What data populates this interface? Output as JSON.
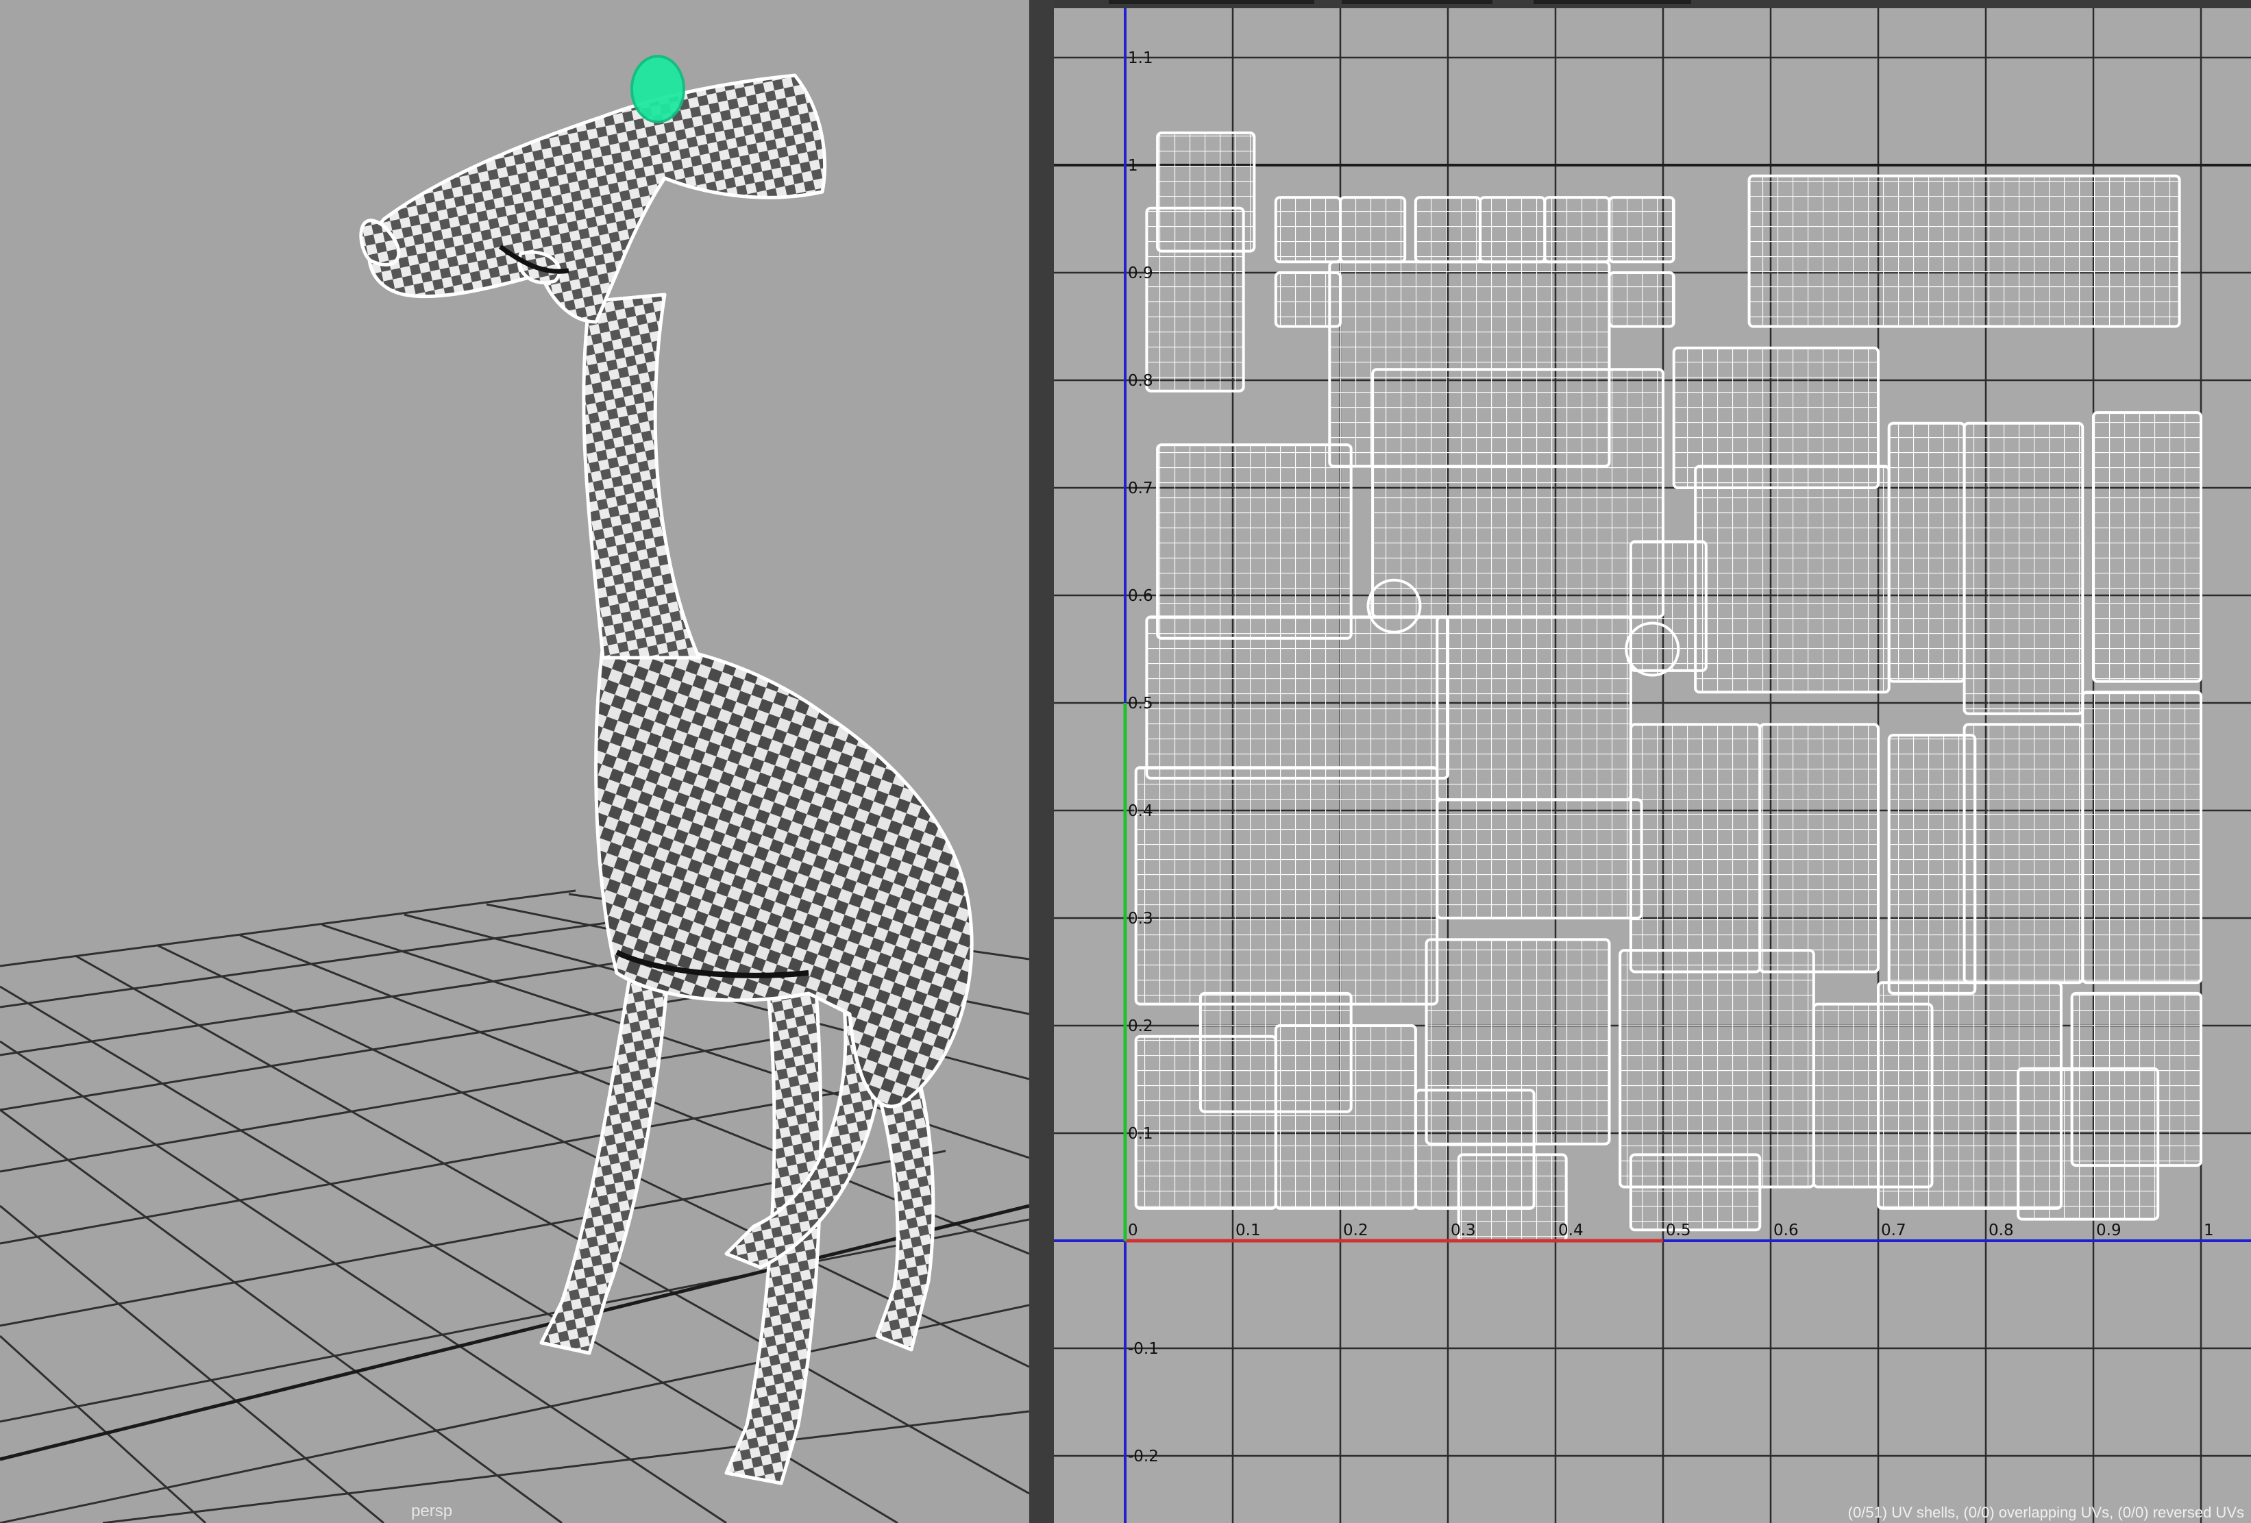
{
  "viewport": {
    "camera_label": "persp",
    "selection_color": "#1ee8a0",
    "grid_color": "#2e2e2e"
  },
  "uv_editor": {
    "y_ticks": [
      "1.1",
      "1",
      "0.9",
      "0.8",
      "0.7",
      "0.6",
      "0.5",
      "0.4",
      "0.3",
      "0.2",
      "0.1",
      "-0.1",
      "-0.2"
    ],
    "x_ticks": [
      "0",
      "0.1",
      "0.2",
      "0.3",
      "0.4",
      "0.5",
      "0.6",
      "0.7",
      "0.8",
      "0.9",
      "1"
    ],
    "status_text": "(0/51) UV shells, (0/0) overlapping UVs, (0/0) reversed UVs",
    "axis_colors": {
      "u_axis": "#d03030",
      "v_axis": "#20c030",
      "zero_line": "#2020d0"
    },
    "shell_color": "#ffffff",
    "grid_color": "#2b2b2b"
  }
}
